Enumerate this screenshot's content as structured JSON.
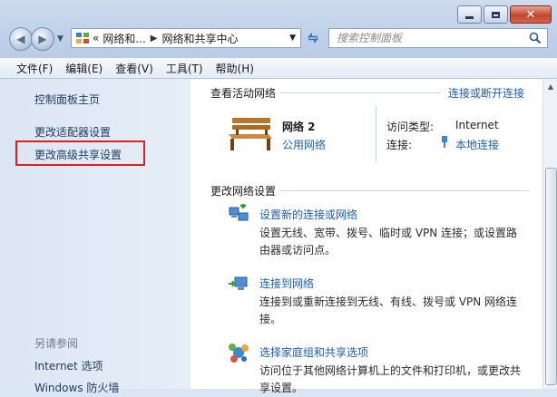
{
  "window": {
    "minimize_icon": "minimize-icon",
    "maximize_icon": "maximize-icon",
    "close_icon": "close-icon"
  },
  "address": {
    "overflow": "«",
    "crumb1": "网络和...",
    "crumb2": "网络和共享中心"
  },
  "search": {
    "placeholder": "搜索控制面板"
  },
  "menu": [
    "文件(F)",
    "编辑(E)",
    "查看(V)",
    "工具(T)",
    "帮助(H)"
  ],
  "sidebar": {
    "home": "控制面板主页",
    "adapter": "更改适配器设置",
    "advanced": "更改高级共享设置",
    "see_also": "另请参阅",
    "internet_options": "Internet 选项",
    "firewall": "Windows 防火墙"
  },
  "active": {
    "title": "查看活动网络",
    "connect_link": "连接或断开连接",
    "network_name": "网络  2",
    "network_type": "公用网络",
    "access_label": "访问类型:",
    "access_value": "Internet",
    "conn_label": "连接:",
    "conn_value": "本地连接"
  },
  "change": {
    "title": "更改网络设置",
    "items": [
      {
        "title": "设置新的连接或网络",
        "desc": "设置无线、宽带、拨号、临时或 VPN 连接；或设置路由器或访问点。"
      },
      {
        "title": "连接到网络",
        "desc": "连接到或重新连接到无线、有线、拨号或 VPN 网络连接。"
      },
      {
        "title": "选择家庭组和共享选项",
        "desc": "访问位于其他网络计算机上的文件和打印机，或更改共享设置。"
      }
    ]
  },
  "colors": {
    "link": "#1f5fb0",
    "highlight": "#e02020",
    "sidebar_bg": "#dce6f3"
  }
}
